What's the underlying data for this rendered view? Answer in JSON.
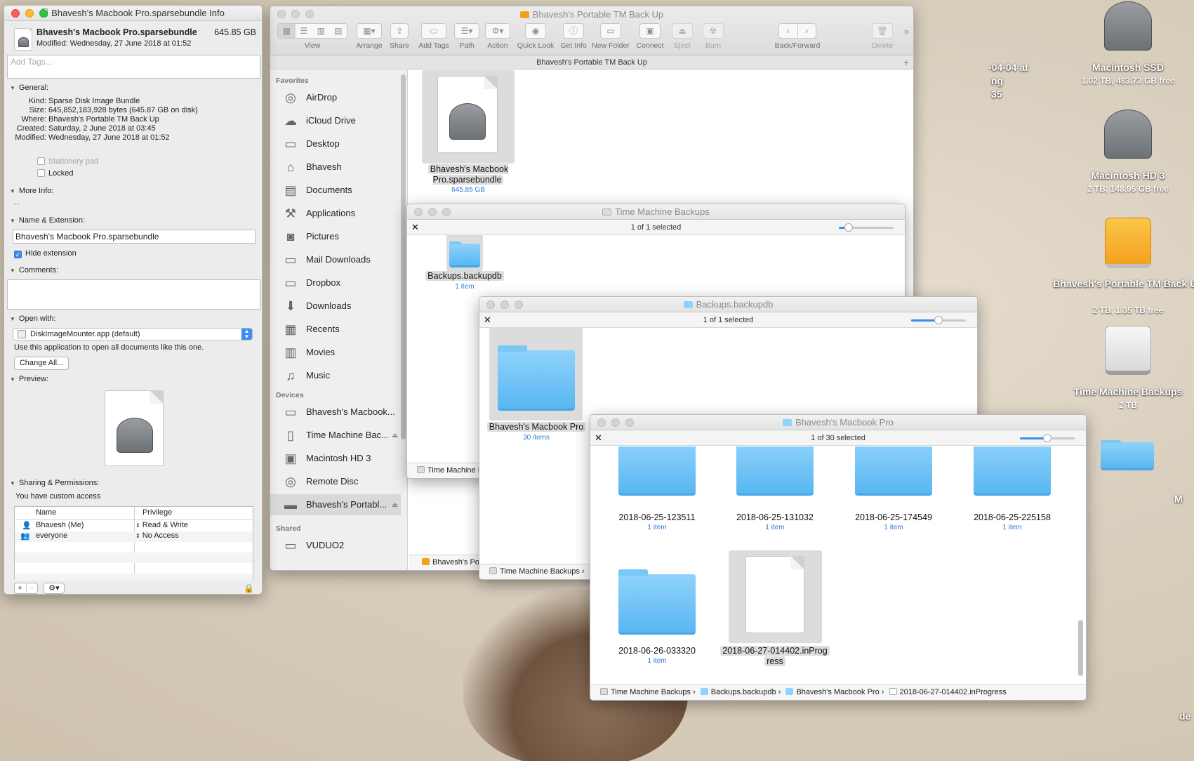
{
  "info_window": {
    "title": "Bhavesh's Macbook Pro.sparsebundle Info",
    "file_name": "Bhavesh's Macbook Pro.sparsebundle",
    "file_size": "645.85 GB",
    "modified_line": "Modified: Wednesday, 27 June 2018 at 01:52",
    "tags_placeholder": "Add Tags...",
    "general_header": "General:",
    "general_rows": [
      {
        "key": "Kind:",
        "value": "Sparse Disk Image Bundle"
      },
      {
        "key": "Size:",
        "value": "645,852,183,928 bytes (645.87 GB on disk)"
      },
      {
        "key": "Where:",
        "value": "Bhavesh's Portable TM Back Up"
      },
      {
        "key": "Created:",
        "value": "Saturday, 2 June 2018 at 03:45"
      },
      {
        "key": "Modified:",
        "value": "Wednesday, 27 June 2018 at 01:52"
      }
    ],
    "stationery_label": "Stationery pad",
    "locked_label": "Locked",
    "more_info_header": "More Info:",
    "more_info_value": "--",
    "name_ext_header": "Name & Extension:",
    "name_value": "Bhavesh's Macbook Pro.sparsebundle",
    "hide_extension_label": "Hide extension",
    "comments_header": "Comments:",
    "open_with_header": "Open with:",
    "open_with_value": "DiskImageMounter.app (default)",
    "open_with_note": "Use this application to open all documents like this one.",
    "change_all_label": "Change All...",
    "preview_header": "Preview:",
    "sharing_header": "Sharing & Permissions:",
    "sharing_note": "You have custom access",
    "perm_columns": [
      "Name",
      "Privilege"
    ],
    "perm_rows": [
      {
        "name": "Bhavesh (Me)",
        "privilege": "Read & Write"
      },
      {
        "name": "everyone",
        "privilege": "No Access"
      }
    ]
  },
  "finder_main": {
    "title": "Bhavesh's Portable TM Back Up",
    "tab_title": "Bhavesh's Portable TM Back Up",
    "toolbar": {
      "view": "View",
      "arrange": "Arrange",
      "share": "Share",
      "add_tags": "Add Tags",
      "path": "Path",
      "action": "Action",
      "quick_look": "Quick Look",
      "get_info": "Get Info",
      "new_folder": "New Folder",
      "connect": "Connect",
      "eject": "Eject",
      "burn": "Burn",
      "back_forward": "Back/Forward",
      "delete": "Delete"
    },
    "sidebar": {
      "favorites_header": "Favorites",
      "favorites": [
        "AirDrop",
        "iCloud Drive",
        "Desktop",
        "Bhavesh",
        "Documents",
        "Applications",
        "Pictures",
        "Mail Downloads",
        "Dropbox",
        "Downloads",
        "Recents",
        "Movies",
        "Music"
      ],
      "devices_header": "Devices",
      "devices": [
        "Bhavesh's Macbook...",
        "Time Machine Bac...",
        "Macintosh HD 3",
        "Remote Disc",
        "Bhavesh's Portabl..."
      ],
      "shared_header": "Shared",
      "shared": [
        "VUDUO2"
      ]
    },
    "item_name": "Bhavesh's Macbook Pro.sparsebundle",
    "item_size": "645.85 GB",
    "pathbar": "Bhavesh's Port"
  },
  "tm_window": {
    "title": "Time Machine Backups",
    "status": "1 of 1 selected",
    "slider_level": 0.18,
    "item_name": "Backups.backupdb",
    "item_sub": "1 item",
    "pathbar": "Time Machine B"
  },
  "backupdb_window": {
    "title": "Backups.backupdb",
    "status": "1 of 1 selected",
    "slider_level": 0.5,
    "item_name": "Bhavesh's Macbook Pro",
    "item_sub": "30 items",
    "pathbar": "Time Machine Backups"
  },
  "mbp_window": {
    "title": "Bhavesh's Macbook Pro",
    "status": "1 of 30 selected",
    "slider_level": 0.5,
    "items": [
      {
        "name": "2018-06-25-123511",
        "sub": "1 item"
      },
      {
        "name": "2018-06-25-131032",
        "sub": "1 item"
      },
      {
        "name": "2018-06-25-174549",
        "sub": "1 item"
      },
      {
        "name": "2018-06-25-225158",
        "sub": "1 item"
      },
      {
        "name": "2018-06-26-033320",
        "sub": "1 item"
      }
    ],
    "selected_item_line1": "2018-06-27-014402.inProg",
    "selected_item_line2": "ress",
    "path": [
      "Time Machine Backups",
      "Backups.backupdb",
      "Bhavesh's Macbook Pro",
      "2018-06-27-014402.inProgress"
    ]
  },
  "desktop": {
    "partial_label_1": "-04-04 at",
    "partial_label_2": "ng",
    "partial_label_3": "35",
    "partial_label_4": "M",
    "partial_label_5": "de",
    "icons": [
      {
        "name": "Macintosh SSD",
        "sub": "1.02 TB, 483.73 GB free"
      },
      {
        "name": "Macintosh HD 3",
        "sub": "2 TB, 148.95 GB free"
      },
      {
        "name": "Bhavesh's Portable TM Back Up",
        "sub": "2 TB, 1.35 TB free"
      },
      {
        "name": "Time Machine Backups",
        "sub": "2 TB"
      }
    ]
  },
  "colors": {
    "folder": "#6cc3f6",
    "accent": "#3b8df0",
    "orange_drive": "#f4a21d"
  }
}
